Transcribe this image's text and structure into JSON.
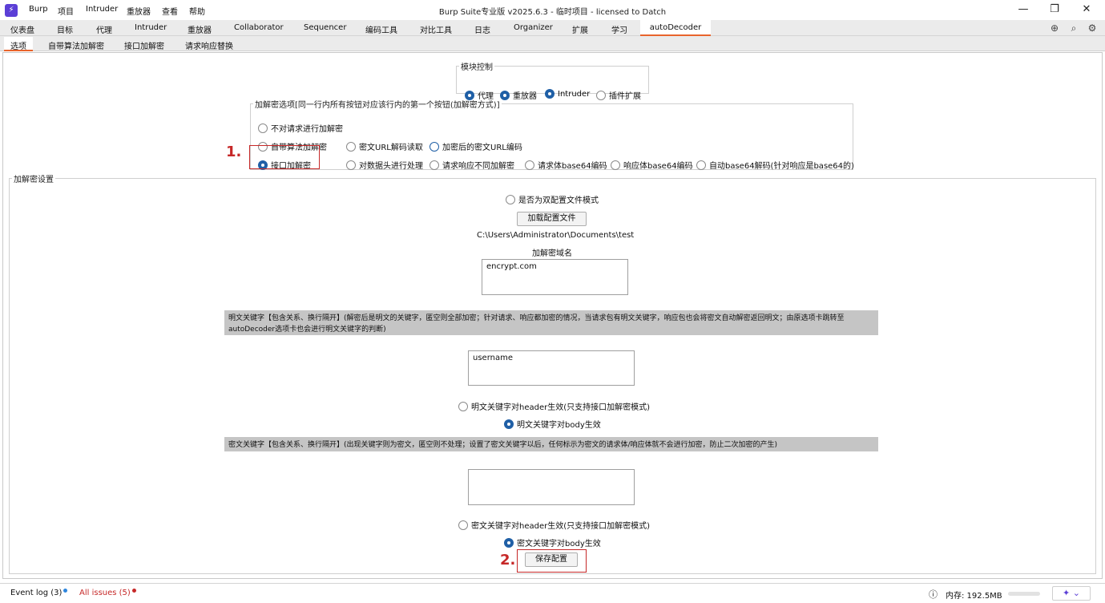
{
  "app": {
    "logo_glyph": "⚡",
    "menu": [
      "Burp",
      "项目",
      "Intruder",
      "重放器",
      "查看",
      "帮助"
    ],
    "window_title": "Burp Suite专业版  v2025.6.3 - 临时项目 - licensed to Datch",
    "window_controls": {
      "minimize": "—",
      "restore": "❐",
      "close": "✕"
    }
  },
  "tabs": [
    "仪表盘",
    "目标",
    "代理",
    "Intruder",
    "重放器",
    "Collaborator",
    "Sequencer",
    "编码工具",
    "对比工具",
    "日志",
    "Organizer",
    "扩展",
    "学习",
    "autoDecoder"
  ],
  "active_tab": "autoDecoder",
  "tab_icons": [
    "globe-icon",
    "search-icon",
    "gear-icon"
  ],
  "subtabs": [
    "选项",
    "自带算法加解密",
    "接口加解密",
    "请求响应替换"
  ],
  "active_subtab": "选项",
  "module_control": {
    "legend": "模块控制",
    "options": [
      {
        "label": "代理",
        "checked": true
      },
      {
        "label": "重放器",
        "checked": true
      },
      {
        "label": "Intruder",
        "checked": true
      },
      {
        "label": "插件扩展",
        "checked": false
      }
    ]
  },
  "crypto_options": {
    "legend": "加解密选项[同一行内所有按钮对应该行内的第一个按钮(加解密方式)]",
    "row1": [
      {
        "label": "不对请求进行加解密",
        "checked": false
      }
    ],
    "row2": [
      {
        "label": "自带算法加解密",
        "checked": false
      },
      {
        "label": "密文URL解码读取",
        "checked": false
      },
      {
        "label": "加密后的密文URL编码",
        "checked": false
      }
    ],
    "row3": [
      {
        "label": "接口加解密",
        "checked": true
      },
      {
        "label": "对数据头进行处理",
        "checked": false
      },
      {
        "label": "请求响应不同加解密",
        "checked": false
      },
      {
        "label": "请求体base64编码",
        "checked": false
      },
      {
        "label": "响应体base64编码",
        "checked": false
      },
      {
        "label": "自动base64解码(针对响应是base64的)",
        "checked": false
      }
    ]
  },
  "settings": {
    "legend": "加解密设置",
    "dual_config": {
      "label": "是否为双配置文件模式",
      "checked": false
    },
    "load_button": "加载配置文件",
    "config_path": "C:\\Users\\Administrator\\Documents\\test",
    "domain_label": "加解密域名",
    "domain_value": "encrypt.com",
    "plain_banner": "明文关键字【包含关系、换行隔开】(解密后是明文的关键字，匿空则全部加密；针对请求、响应都加密的情况，当请求包有明文关键字，响应包也会将密文自动解密返回明文；由原选项卡跳转至autoDecoder选项卡也会进行明文关键字的判断)",
    "plain_value": "username",
    "plain_header": {
      "label": "明文关键字对header生效(只支持接口加解密模式)",
      "checked": false
    },
    "plain_body": {
      "label": "明文关键字对body生效",
      "checked": true
    },
    "cipher_banner": "密文关键字【包含关系、换行隔开】(出现关键字则为密文，匿空则不处理；设置了密文关键字以后，任何标示为密文的请求体/响应体就不会进行加密，防止二次加密的产生)",
    "cipher_value": "",
    "cipher_header": {
      "label": "密文关键字对header生效(只支持接口加解密模式)",
      "checked": false
    },
    "cipher_body": {
      "label": "密文关键字对body生效",
      "checked": true
    },
    "save_button": "保存配置"
  },
  "annotations": {
    "step1": "1.",
    "step2": "2.",
    "color": "#c62828"
  },
  "accent_color": "#e8642c",
  "status": {
    "event_log": "Event log (3)",
    "all_issues": "All issues (5)",
    "memory": "内存: 192.5MB",
    "info_icon": "ⓘ"
  }
}
